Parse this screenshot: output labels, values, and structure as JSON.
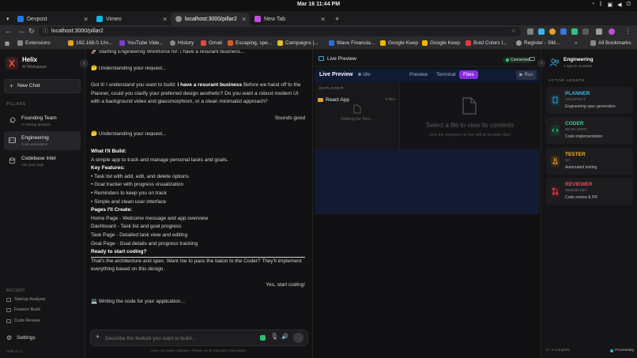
{
  "os": {
    "clock": "Mar 16  11:44 PM"
  },
  "tabs": [
    {
      "label": "Devpost",
      "color": "#1f7ae0"
    },
    {
      "label": "Vimeo",
      "color": "#17b4e8"
    },
    {
      "label": "localhost:3000/pillar2",
      "color": "#8f8f8f"
    },
    {
      "label": "New Tab",
      "color": "#c24de0"
    }
  ],
  "address": {
    "url": "localhost:3000/pillar2"
  },
  "bookmarks": [
    {
      "label": "Extensions",
      "color": "#888888"
    },
    {
      "label": "192.168.0.1/in...",
      "color": "#e0a32b"
    },
    {
      "label": "YouTube Vide...",
      "color": "#7a3ed6"
    },
    {
      "label": "History",
      "color": "#888888"
    },
    {
      "label": "Gmail",
      "color": "#e04a3b"
    },
    {
      "label": "Escaping, spe...",
      "color": "#d65a2f"
    },
    {
      "label": "Campaigns |...",
      "color": "#e0c02b"
    },
    {
      "label": "Wave Financia...",
      "color": "#2b6fe0"
    },
    {
      "label": "Google Keep",
      "color": "#f2b705"
    },
    {
      "label": "Google Keep",
      "color": "#f2b705"
    },
    {
      "label": "Bold Colors I...",
      "color": "#e03b3b"
    },
    {
      "label": "Register - SM...",
      "color": "#9a9a9a"
    },
    {
      "label": "All Bookmarks",
      "color": "#888888"
    }
  ],
  "sidebar": {
    "brand": "Helix",
    "brand_sub": "AI Workspace",
    "new_chat": "New Chat",
    "pillars_label": "PILLARS",
    "pillars": [
      {
        "title": "Founding Team",
        "sub": "AI startup analysis"
      },
      {
        "title": "Engineering",
        "sub": "Code generation"
      },
      {
        "title": "Codebase Intel",
        "sub": "Ask your code"
      }
    ],
    "recent_label": "RECENT",
    "recent": [
      "Startup Analysis",
      "Feature Build",
      "Code Review"
    ],
    "settings": "Settings",
    "version": "Helix v1.0"
  },
  "chat": {
    "m0": "🚀 Starting Engineering Workforce for: i have a resurant business...",
    "m1": "🤔 Understanding your request...",
    "m2_pre": "Got it! I understand you want to build: ",
    "m2_bold": "i have a resurant business",
    "m2_post": " Before we hand off to the Planner, could you clarify your preferred design aesthetic? Do you want a robust modern UI with a background video and glassmorphism, or a clean minimalist approach?",
    "m3": "Sounds good",
    "m4": "🤔 Understanding your request...",
    "plan_title": "What I'll Build:",
    "plan_desc": "A simple app to track and manage personal tasks and goals.",
    "features_title": "Key Features:",
    "features": [
      "• Task list with add, edit, and delete options",
      "• Goal tracker with progress visualization",
      "• Reminders to keep you on track",
      "• Simple and clean user interface"
    ],
    "pages_title": "Pages I'll Create:",
    "pages": [
      "Home Page - Welcome message and app overview",
      "Dashboard - Task list and goal progress",
      "Task Page - Detailed task view and editing",
      "Goal Page - Goal details and progress tracking"
    ],
    "ready": "Ready to start coding?",
    "handoff": "That's the architecture and spec. Want me to pass the baton to the Coder? They'll implement everything based on this design.",
    "m5": "Yes, start coding!",
    "m6": "💻 Writing the code for your application...",
    "placeholder": "Describe the feature you want to build...",
    "disclaimer": "Helix can make mistakes. Please verify important information."
  },
  "preview": {
    "header": "Live Preview",
    "connected": "Connected",
    "bar_title": "Live Preview",
    "status": "Idle",
    "tabs": [
      "Preview",
      "Terminal",
      "Files"
    ],
    "active_tab": "Files",
    "run": "Run",
    "explorer_label": "EXPLORER",
    "folder": "React App",
    "folder_count": "0 files",
    "waiting": "Waiting for files...",
    "empty_title": "Select a file to view its contents",
    "empty_sub": "Use the explorer on the left to browse files"
  },
  "agents": {
    "title": "Engineering",
    "sub": "4 agents available",
    "label": "ACTIVE AGENTS",
    "list": [
      {
        "name": "PLANNER",
        "role": "ARCHITECT",
        "desc": "Engineering spec generation",
        "color": "#39b6e6"
      },
      {
        "name": "CODER",
        "role": "DEVELOPER",
        "desc": "Code implementation",
        "color": "#3fd08a"
      },
      {
        "name": "TESTER",
        "role": "QA",
        "desc": "Automated testing",
        "color": "#f0b429"
      },
      {
        "name": "REVIEWER",
        "role": "SENIOR DEV",
        "desc": "Code review & PR",
        "color": "#ef4a5a"
      }
    ],
    "footer_left": "0 / 4 complete",
    "footer_right": "Processing"
  }
}
